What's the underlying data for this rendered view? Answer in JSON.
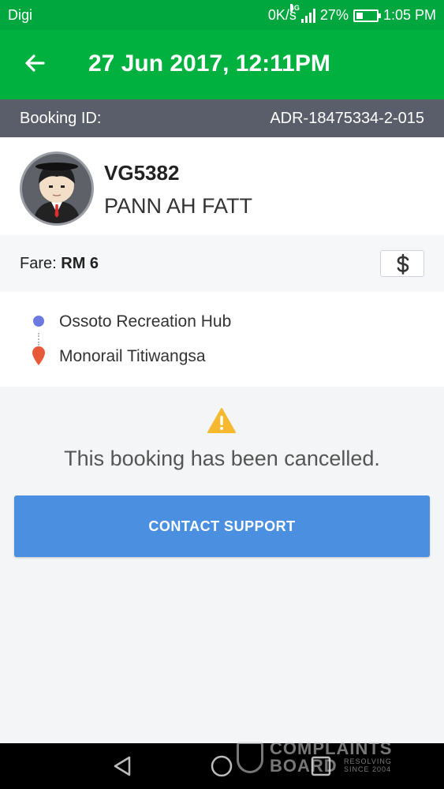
{
  "status_bar": {
    "carrier": "Digi",
    "net_speed": "0K/s",
    "network_type": "4G",
    "battery": "27%",
    "battery_level": 0.27,
    "time": "1:05 PM"
  },
  "header": {
    "title": "27 Jun 2017, 12:11PM",
    "back_icon": "arrow-left-icon"
  },
  "booking": {
    "label": "Booking ID:",
    "id": "ADR-18475334-2-015"
  },
  "driver": {
    "plate": "VG5382",
    "name": "PANN AH FATT"
  },
  "fare": {
    "label": "Fare:",
    "amount": "RM 6",
    "payment_icon": "dollar-icon"
  },
  "route": {
    "pickup": "Ossoto Recreation Hub",
    "dropoff": "Monorail Titiwangsa"
  },
  "cancellation": {
    "icon": "warning-icon",
    "message": "This booking has been cancelled.",
    "button_label": "CONTACT SUPPORT"
  },
  "watermark": {
    "line1": "COMPLAINTS",
    "line2": "BOARD",
    "tag1": "RESOLVING",
    "tag2": "SINCE 2004"
  },
  "colors": {
    "header_green": "#00b140",
    "status_green": "#00a63e",
    "booking_bar": "#5a5e6a",
    "button_blue": "#4a8fe0",
    "warning_yellow": "#f5b82e",
    "pickup_dot": "#6b7ae0",
    "dropoff_pin": "#e8593a"
  }
}
